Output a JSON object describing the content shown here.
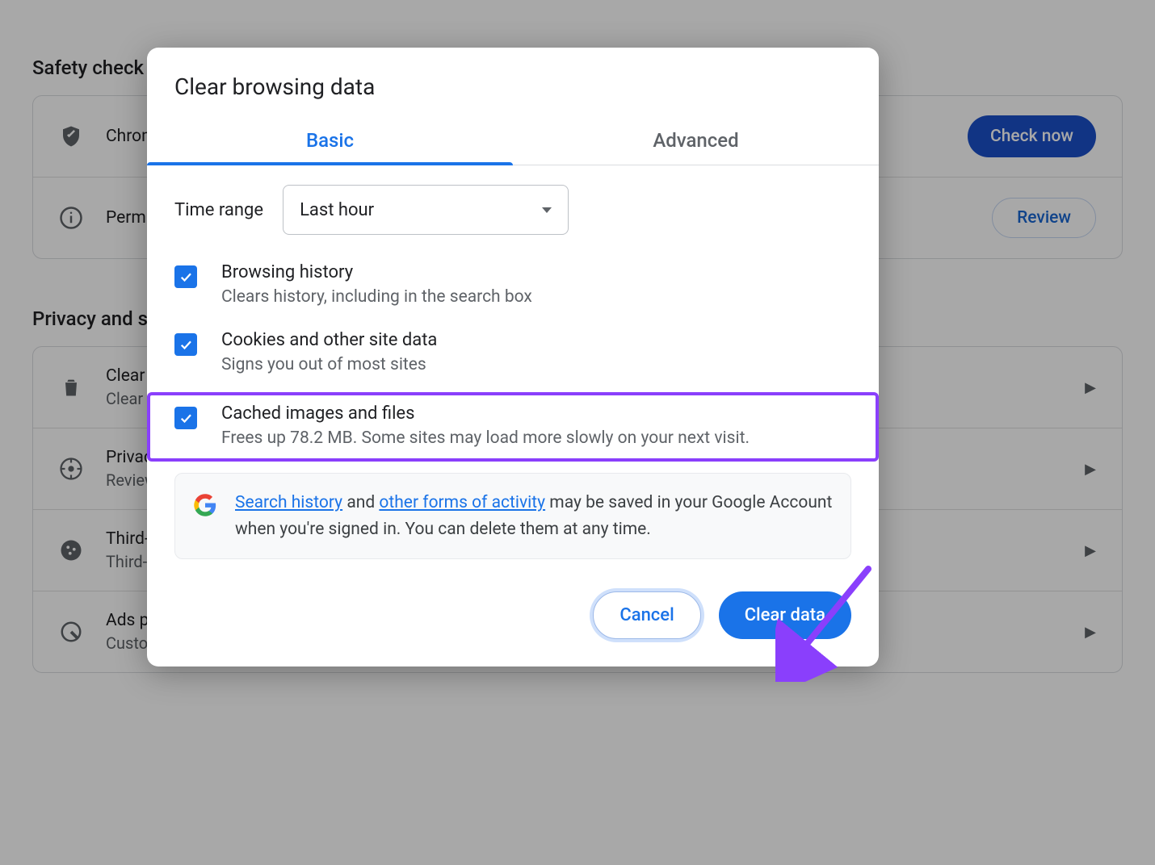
{
  "background": {
    "safety_check_heading": "Safety check",
    "safety_row_title": "Chrome",
    "check_now_button": "Check now",
    "permissions_row_title": "Permissions",
    "review_button": "Review",
    "privacy_heading": "Privacy and security",
    "rows": {
      "clear": {
        "title": "Clear browsing data",
        "sub": "Clear history, cookies, cache, and more"
      },
      "privacy": {
        "title": "Privacy",
        "sub": "Review key privacy controls"
      },
      "third": {
        "title": "Third-party cookies",
        "sub": "Third-party cookies are blocked"
      },
      "ads": {
        "title": "Ads privacy",
        "sub": "Customize the info used by sites to show you ads"
      }
    }
  },
  "dialog": {
    "title": "Clear browsing data",
    "tabs": {
      "basic": "Basic",
      "advanced": "Advanced"
    },
    "time_range_label": "Time range",
    "time_range_value": "Last hour",
    "checks": {
      "history": {
        "title": "Browsing history",
        "sub": "Clears history, including in the search box"
      },
      "cookies": {
        "title": "Cookies and other site data",
        "sub": "Signs you out of most sites"
      },
      "cache": {
        "title": "Cached images and files",
        "sub": "Frees up 78.2 MB. Some sites may load more slowly on your next visit."
      }
    },
    "info": {
      "link_search_history": "Search history",
      "mid_text_1": " and ",
      "link_other_forms": "other forms of activity",
      "rest": " may be saved in your Google Account when you're signed in. You can delete them at any time."
    },
    "buttons": {
      "cancel": "Cancel",
      "clear": "Clear data"
    }
  }
}
